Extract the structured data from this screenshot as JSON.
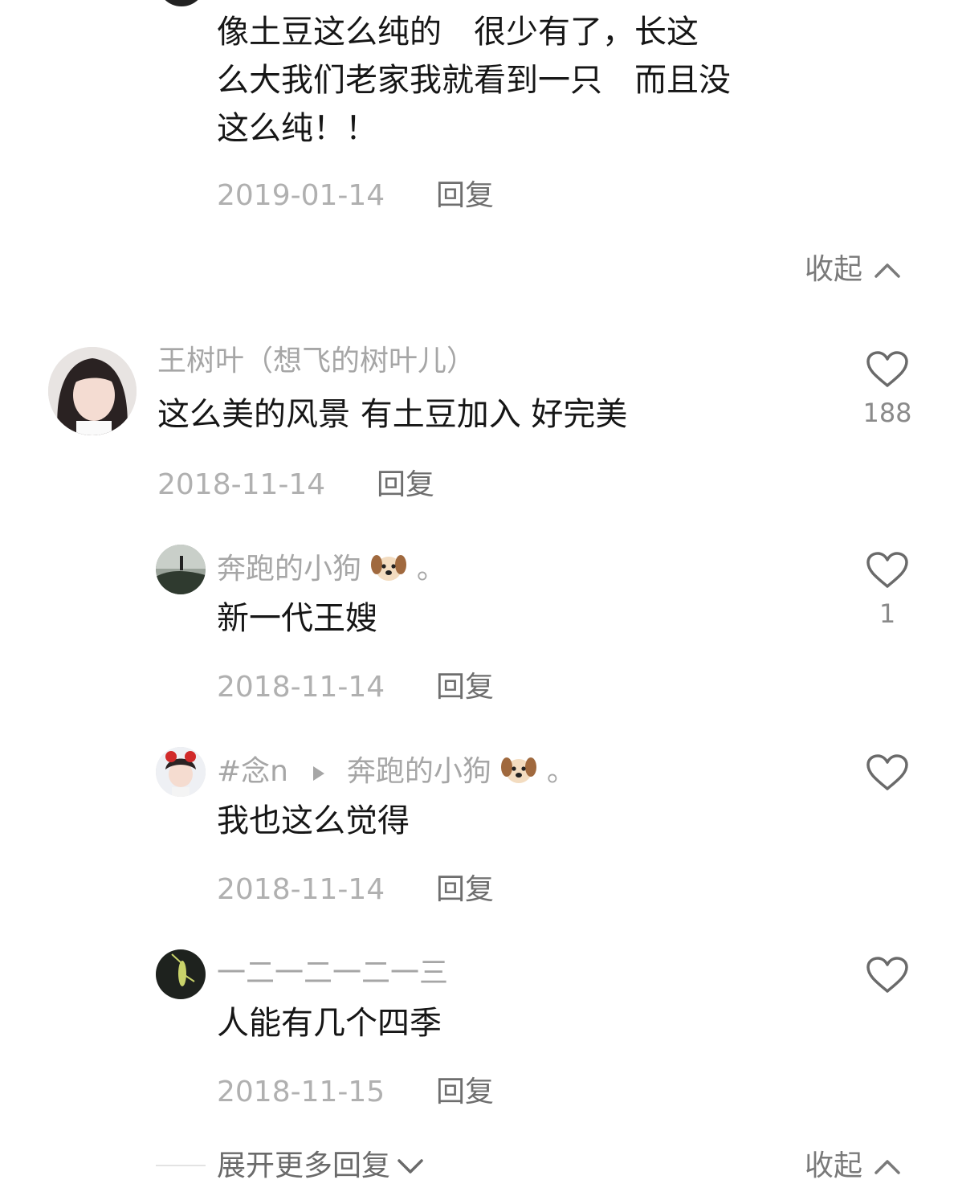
{
  "top_comment": {
    "lines": [
      "像土豆这么纯的　很少有了，长这",
      "么大我们老家我就看到一只　而且没",
      "这么纯！！"
    ],
    "date": "2019-01-14",
    "reply_label": "回复"
  },
  "collapse_top": {
    "label": "收起"
  },
  "main_comment": {
    "author": "王树叶（想飞的树叶儿）",
    "text": "这么美的风景 有土豆加入 好完美",
    "likes": "188",
    "date": "2018-11-14",
    "reply_label": "回复"
  },
  "replies": [
    {
      "author": "奔跑的小狗",
      "author_suffix": "。",
      "text": "新一代王嫂",
      "likes": "1",
      "date": "2018-11-14",
      "reply_label": "回复"
    },
    {
      "author": "#念n",
      "reply_to": "奔跑的小狗",
      "reply_to_suffix": "。",
      "text": "我也这么觉得",
      "likes": "",
      "date": "2018-11-14",
      "reply_label": "回复"
    },
    {
      "author": "一二一二一二一三",
      "text": "人能有几个四季",
      "likes": "",
      "date": "2018-11-15",
      "reply_label": "回复"
    }
  ],
  "footer": {
    "expand_label": "展开更多回复",
    "collapse_label": "收起"
  }
}
